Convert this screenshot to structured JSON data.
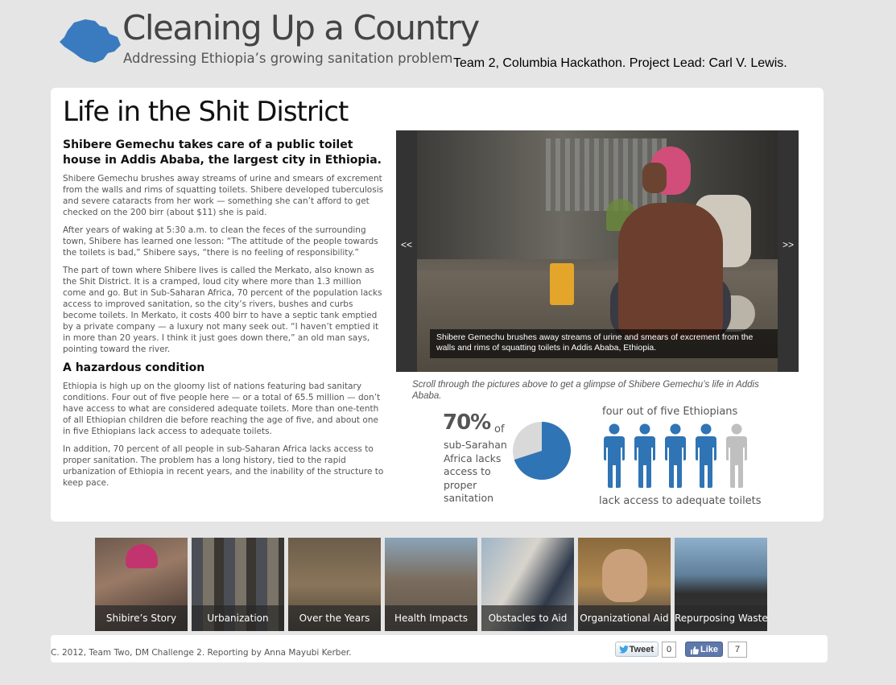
{
  "site": {
    "title": "Cleaning Up a Country",
    "subtitle": "Addressing Ethiopia’s growing sanitation problem",
    "team_line": "Team 2, Columbia Hackathon. Project Lead: Carl V. Lewis.",
    "logo_icon": "ethiopia-map-icon",
    "accent_color": "#3a7bbf"
  },
  "article": {
    "headline": "Life in the Shit District",
    "dek": "Shibere Gemechu takes care of a public toilet house in Addis Ababa, the largest city in Ethiopia.",
    "paragraphs": [
      "Shibere Gemechu brushes away streams of urine and smears of excrement from the walls and rims of squatting toilets. Shibere developed tuberculosis and severe cataracts from her work — something she can’t afford to get checked on the 200 birr (about $11) she is paid.",
      "After years of waking at 5:30 a.m. to clean the feces of the surrounding town, Shibere has learned one lesson: “The attitude of the people towards the toilets is bad,” Shibere says, “there is no feeling of responsibility.”",
      "The part of town where Shibere lives is called the Merkato, also known as the Shit District. It is a cramped, loud city where more than 1.3 million come and go. But in Sub-Saharan Africa, 70 percent of the population lacks access to improved sanitation, so the city’s rivers, bushes and curbs become toilets. In Merkato, it costs 400 birr to have a septic tank emptied by a private company — a luxury not many seek out. “I haven’t emptied it in more than 20 years. I think it just goes down there,” an old man says, pointing toward the river."
    ],
    "subhead": "A hazardous condition",
    "paragraphs2": [
      "Ethiopia is high up on the gloomy list of nations featuring bad sanitary conditions. Four out of five people here — or a total of 65.5 million — don’t have access to what are considered adequate toilets. More than one-tenth of all Ethiopian children die before reaching the age of five, and about one in five Ethiopians lack access to adequate toilets.",
      "In addition, 70 percent of all people in sub-Saharan Africa lacks access to proper sanitation. The problem has a long history, tied to the rapid urbanization of Ethiopia in recent years, and the inability of the structure to keep pace."
    ]
  },
  "slideshow": {
    "prev_label": "<<",
    "next_label": ">>",
    "caption": "Shibere Gemechu brushes away streams of urine and smears of excrement from the walls and rims of squatting toilets in Addis Ababa, Ethiopia.",
    "note": "Scroll through the pictures above to get a glimpse of Shibere Gemechu’s life in Addis Ababa."
  },
  "infographic": {
    "stat_pct": "70%",
    "stat_of": "of",
    "stat_desc": "sub-Sarahan Africa lacks access to proper sanitation",
    "pie_fraction": 0.7,
    "pie_color": "#2f74b5",
    "pie_rest_color": "#d9d9d9",
    "people_title": "four out of five Ethiopians",
    "people_footer": "lack access to adequate toilets",
    "people_total": 5,
    "people_highlighted": 4,
    "person_color": "#2f74b5",
    "person_rest_color": "#bfbfbf"
  },
  "tiles": [
    {
      "label": "Shibire’s Story"
    },
    {
      "label": "Urbanization"
    },
    {
      "label": "Over the Years"
    },
    {
      "label": "Health Impacts"
    },
    {
      "label": "Obstacles to Aid"
    },
    {
      "label": "Organizational Aid"
    },
    {
      "label": "Repurposing Waste"
    }
  ],
  "footer": {
    "credit": "C. 2012, Team Two, DM Challenge 2. Reporting by Anna Mayubi Kerber.",
    "tweet_label": "Tweet",
    "tweet_count": "0",
    "like_label": "Like",
    "like_count": "7"
  }
}
